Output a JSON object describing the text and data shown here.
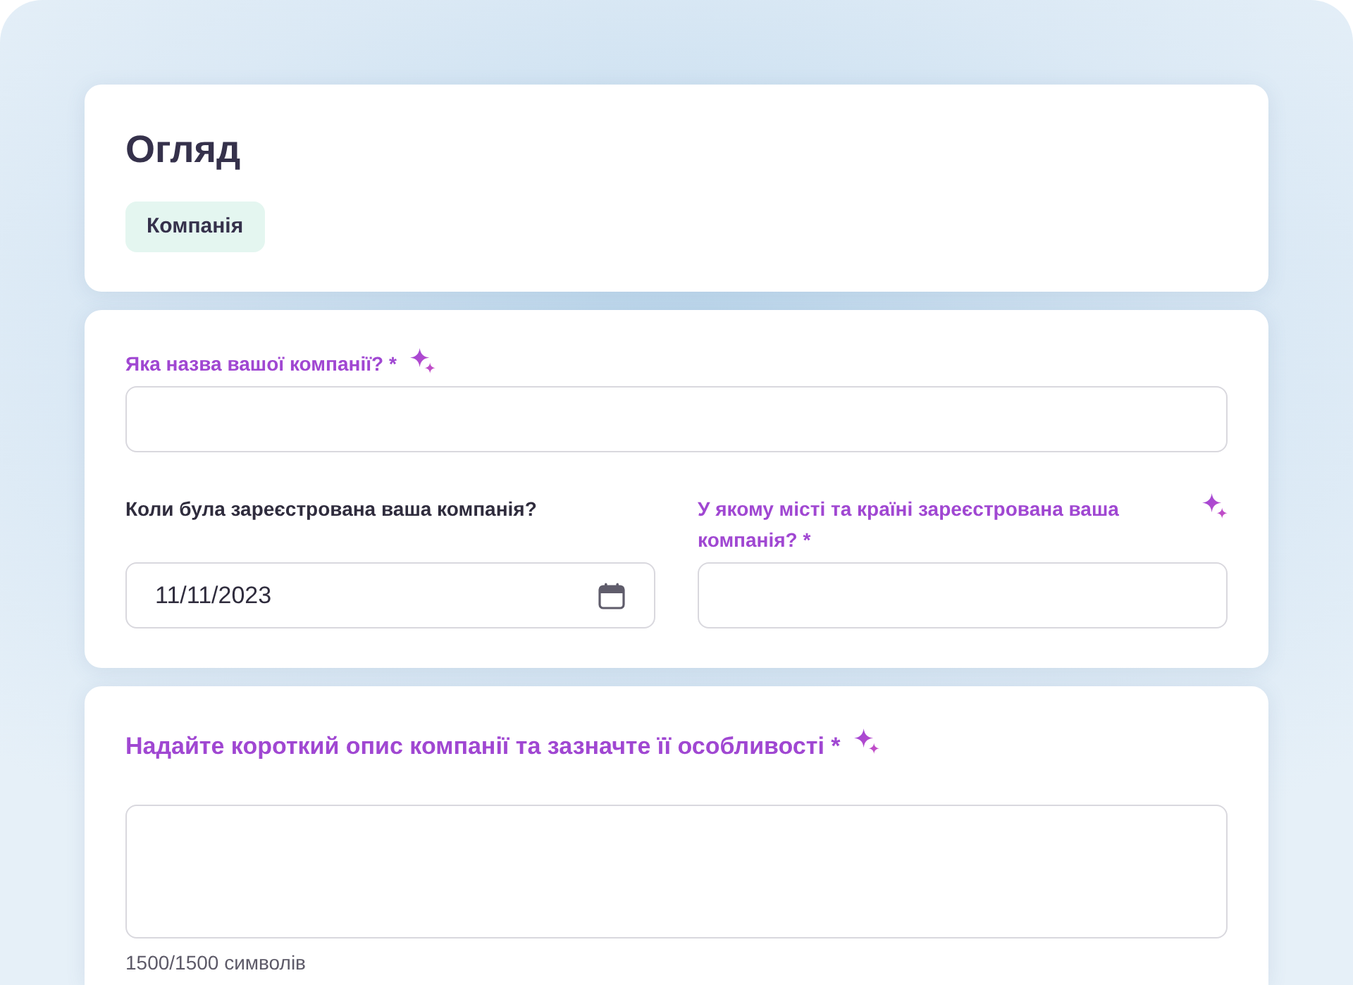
{
  "overview": {
    "title": "Огляд",
    "tag": "Компанія"
  },
  "sections": [
    {
      "rows": [
        [
          {
            "kind": "text",
            "label": "Яка назва вашої компанії? *",
            "ai_suggested": true
          }
        ],
        [
          {
            "kind": "date",
            "label": "Коли була зареєстрована ваша компанія?",
            "ai_suggested": false,
            "value": "11/11/2023"
          },
          {
            "kind": "text",
            "label": "У якому місті та країні зареєстрована ваша компанія? *",
            "ai_suggested": true
          }
        ]
      ]
    },
    {
      "rows": [
        [
          {
            "kind": "textarea",
            "label": "Надайте короткий опис компанії та зазначте її особливості *",
            "ai_suggested": true,
            "counter": "1500/1500 символів"
          }
        ]
      ]
    }
  ]
}
